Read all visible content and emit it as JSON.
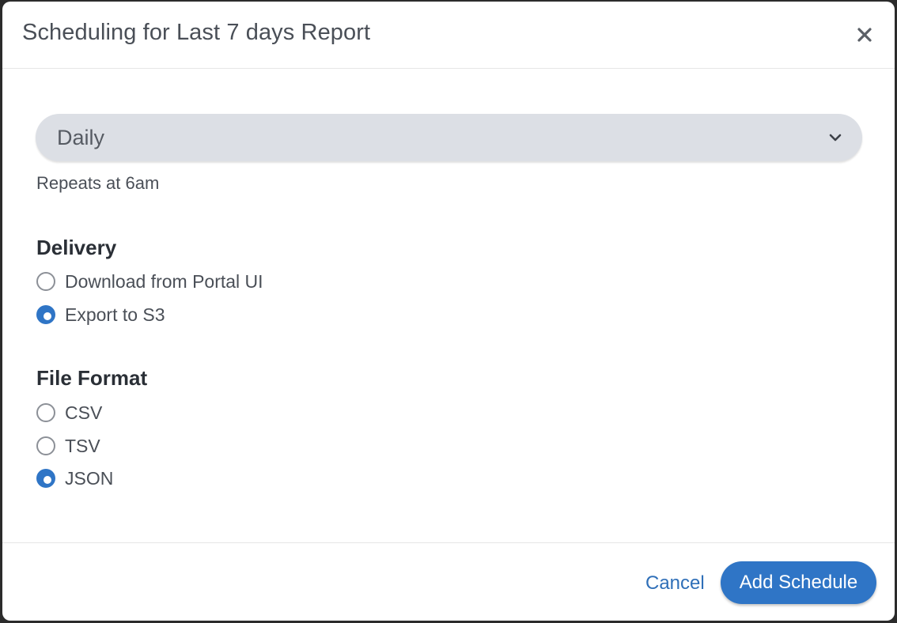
{
  "modal": {
    "title": "Scheduling for Last 7 days Report",
    "close_icon": "close-icon"
  },
  "frequency": {
    "selected": "Daily",
    "chevron_icon": "chevron-down-icon",
    "helper_text": "Repeats at 6am"
  },
  "delivery": {
    "title": "Delivery",
    "options": [
      {
        "label": "Download from Portal UI",
        "checked": false
      },
      {
        "label": "Export to S3",
        "checked": true
      }
    ]
  },
  "file_format": {
    "title": "File Format",
    "options": [
      {
        "label": "CSV",
        "checked": false
      },
      {
        "label": "TSV",
        "checked": false
      },
      {
        "label": "JSON",
        "checked": true
      }
    ]
  },
  "footer": {
    "cancel_label": "Cancel",
    "submit_label": "Add Schedule"
  },
  "colors": {
    "accent": "#2f75c6",
    "select_bg": "#dcdfe5",
    "link": "#2f6fb8"
  }
}
